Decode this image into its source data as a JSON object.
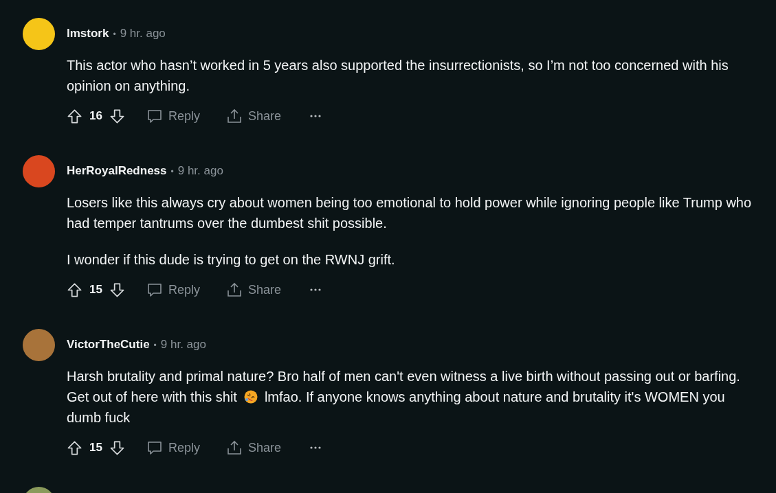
{
  "comments": [
    {
      "username": "lmstork",
      "separator": "•",
      "time": "9 hr. ago",
      "color": "#f5c518",
      "paragraphs": [
        [
          {
            "kind": "text",
            "text": "This actor who hasn’t worked in 5 years also supported the insurrectionists, so I’m not too concerned with his opinion on anything."
          }
        ]
      ],
      "score": "16",
      "reply": "Reply",
      "share": "Share"
    },
    {
      "username": "HerRoyalRedness",
      "separator": "•",
      "time": "9 hr. ago",
      "color": "#d9471f",
      "paragraphs": [
        [
          {
            "kind": "text",
            "text": "Losers like this always cry about women being too emotional to hold power while ignoring people like Trump who had temper tantrums over the dumbest shit possible."
          }
        ],
        [
          {
            "kind": "text",
            "text": "I wonder if this dude is trying to get on the RWNJ grift."
          }
        ]
      ],
      "score": "15",
      "reply": "Reply",
      "share": "Share"
    },
    {
      "username": "VictorTheCutie",
      "separator": "•",
      "time": "9 hr. ago",
      "color": "#a8733a",
      "paragraphs": [
        [
          {
            "kind": "line",
            "text": "Harsh brutality and primal nature? Bro half of men can't even witness a live birth without passing out or barfing."
          },
          {
            "kind": "line",
            "text": "Get out of here with this shit"
          },
          {
            "kind": "emoji"
          },
          {
            "kind": "line",
            "text": "lmfao. If anyone knows anything about nature and brutality it's WOMEN you"
          },
          {
            "kind": "line",
            "text": "dumb fuck"
          }
        ]
      ],
      "score": "15",
      "reply": "Reply",
      "share": "Share"
    },
    {
      "color": "#8a9a5b"
    }
  ]
}
